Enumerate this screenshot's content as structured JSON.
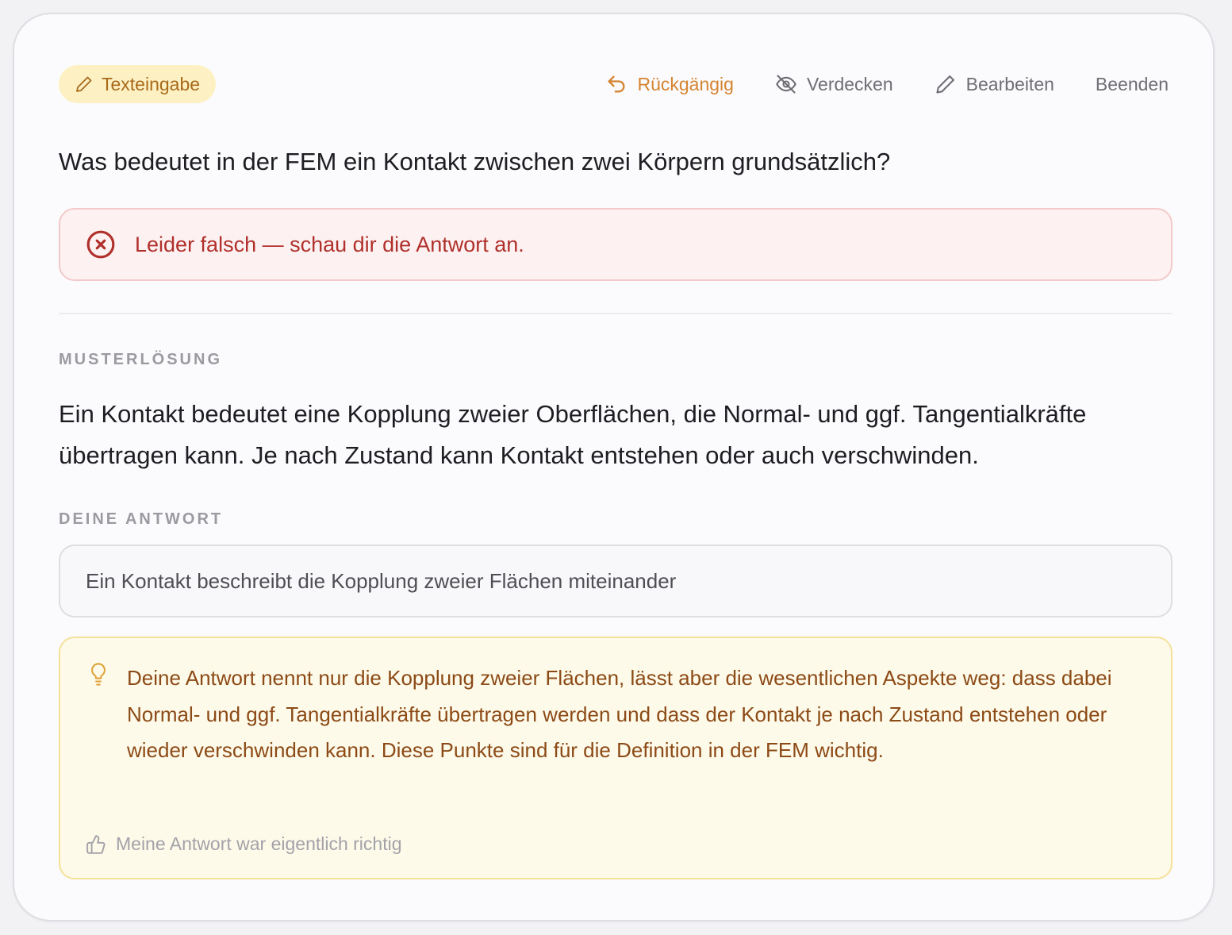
{
  "toolbar": {
    "mode_label": "Texteingabe",
    "undo_label": "Rückgängig",
    "hide_label": "Verdecken",
    "edit_label": "Bearbeiten",
    "finish_label": "Beenden"
  },
  "question": "Was bedeutet in der FEM ein Kontakt zwischen zwei Körpern grundsätzlich?",
  "result": {
    "message": "Leider falsch — schau dir die Antwort an."
  },
  "solution": {
    "label": "MUSTERLÖSUNG",
    "text": "Ein Kontakt bedeutet eine Kopplung zweier Oberflächen, die Normal- und ggf. Tangentialkräfte übertragen kann. Je nach Zustand kann Kontakt entstehen oder auch verschwinden."
  },
  "user_answer": {
    "label": "DEINE ANTWORT",
    "text": "Ein Kontakt beschreibt die Kopplung zweier Flächen miteinander"
  },
  "feedback": {
    "text": "Deine Antwort nennt nur die Kopplung zweier Flächen, lässt aber die wesentlichen Aspekte weg: dass dabei Normal- und ggf. Tangentialkräfte übertragen werden und dass der Kontakt je nach Zustand entstehen oder wieder verschwinden kann. Diese Punkte sind für die Definition in der FEM wichtig.",
    "dispute_label": "Meine Antwort war eigentlich richtig"
  },
  "colors": {
    "accent": "#d58432",
    "error": "#b0302c",
    "feedback_text": "#8c4a16"
  }
}
